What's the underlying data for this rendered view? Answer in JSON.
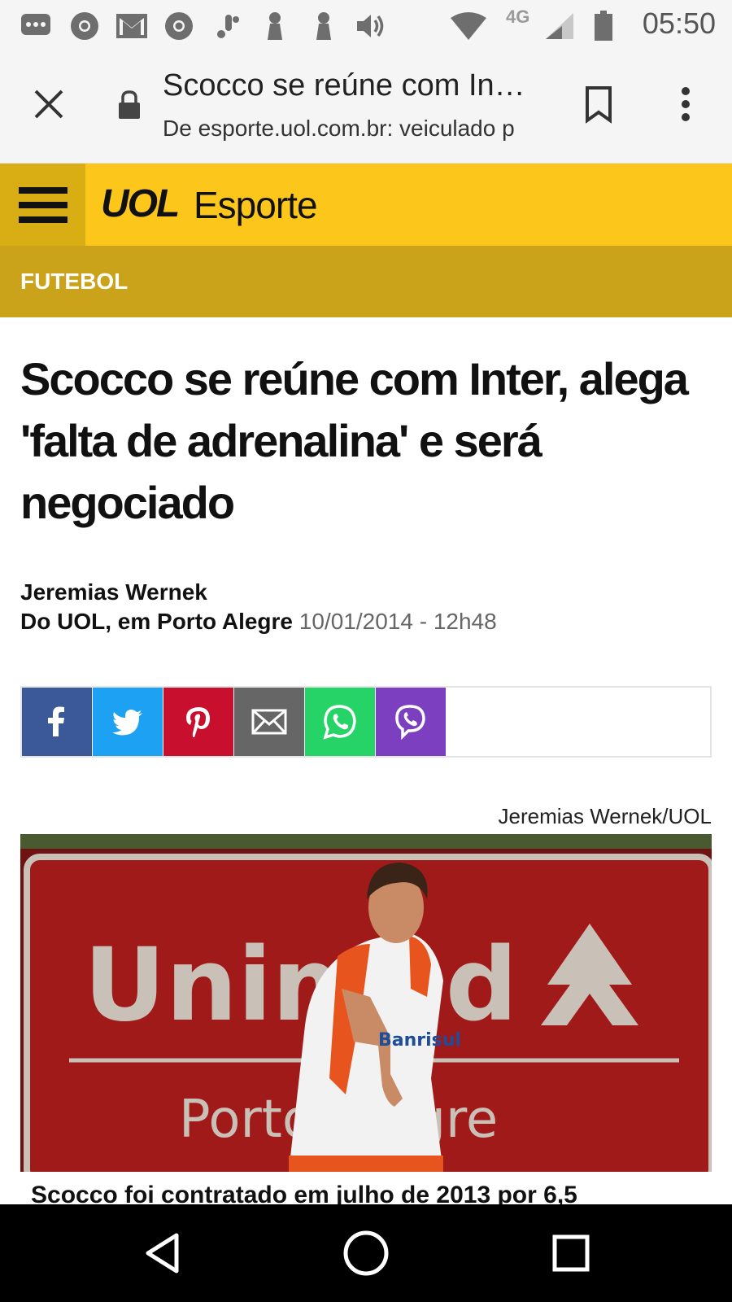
{
  "status_bar": {
    "time": "05:50",
    "network": "4G",
    "icons": [
      "message-icon",
      "chrome-icon",
      "gmail-icon",
      "chrome-icon",
      "notification-icon",
      "notification-icon",
      "notification-icon",
      "volume-icon",
      "wifi-icon",
      "signal-icon",
      "battery-icon"
    ]
  },
  "browser": {
    "title": "Scocco se reúne com In…",
    "url": "De esporte.uol.com.br: veiculado p"
  },
  "site": {
    "logo": "UOL",
    "section": "Esporte",
    "category": "FUTEBOL",
    "colors": {
      "brand_yellow": "#fcc71a",
      "category_gold": "#cba31a"
    }
  },
  "article": {
    "headline": "Scocco se reúne com Inter, alega 'falta de adrenalina' e será negociado",
    "author": "Jeremias Wernek",
    "location": "Do UOL, em Porto Alegre",
    "date": "10/01/2014 - 12h48",
    "photo_credit": "Jeremias Wernek/UOL",
    "caption": "Scocco foi contratado em julho de 2013 por 6,5",
    "photo_text": {
      "sign_big": "Unimed",
      "sign_small": "Porto Alegre",
      "shirt": "Banrisul"
    }
  },
  "share": {
    "buttons": [
      {
        "name": "facebook",
        "color": "#3b5998"
      },
      {
        "name": "twitter",
        "color": "#1da1f2"
      },
      {
        "name": "pinterest",
        "color": "#c8102e"
      },
      {
        "name": "email",
        "color": "#666666"
      },
      {
        "name": "whatsapp",
        "color": "#25d366"
      },
      {
        "name": "viber",
        "color": "#7b3fbf"
      }
    ]
  }
}
